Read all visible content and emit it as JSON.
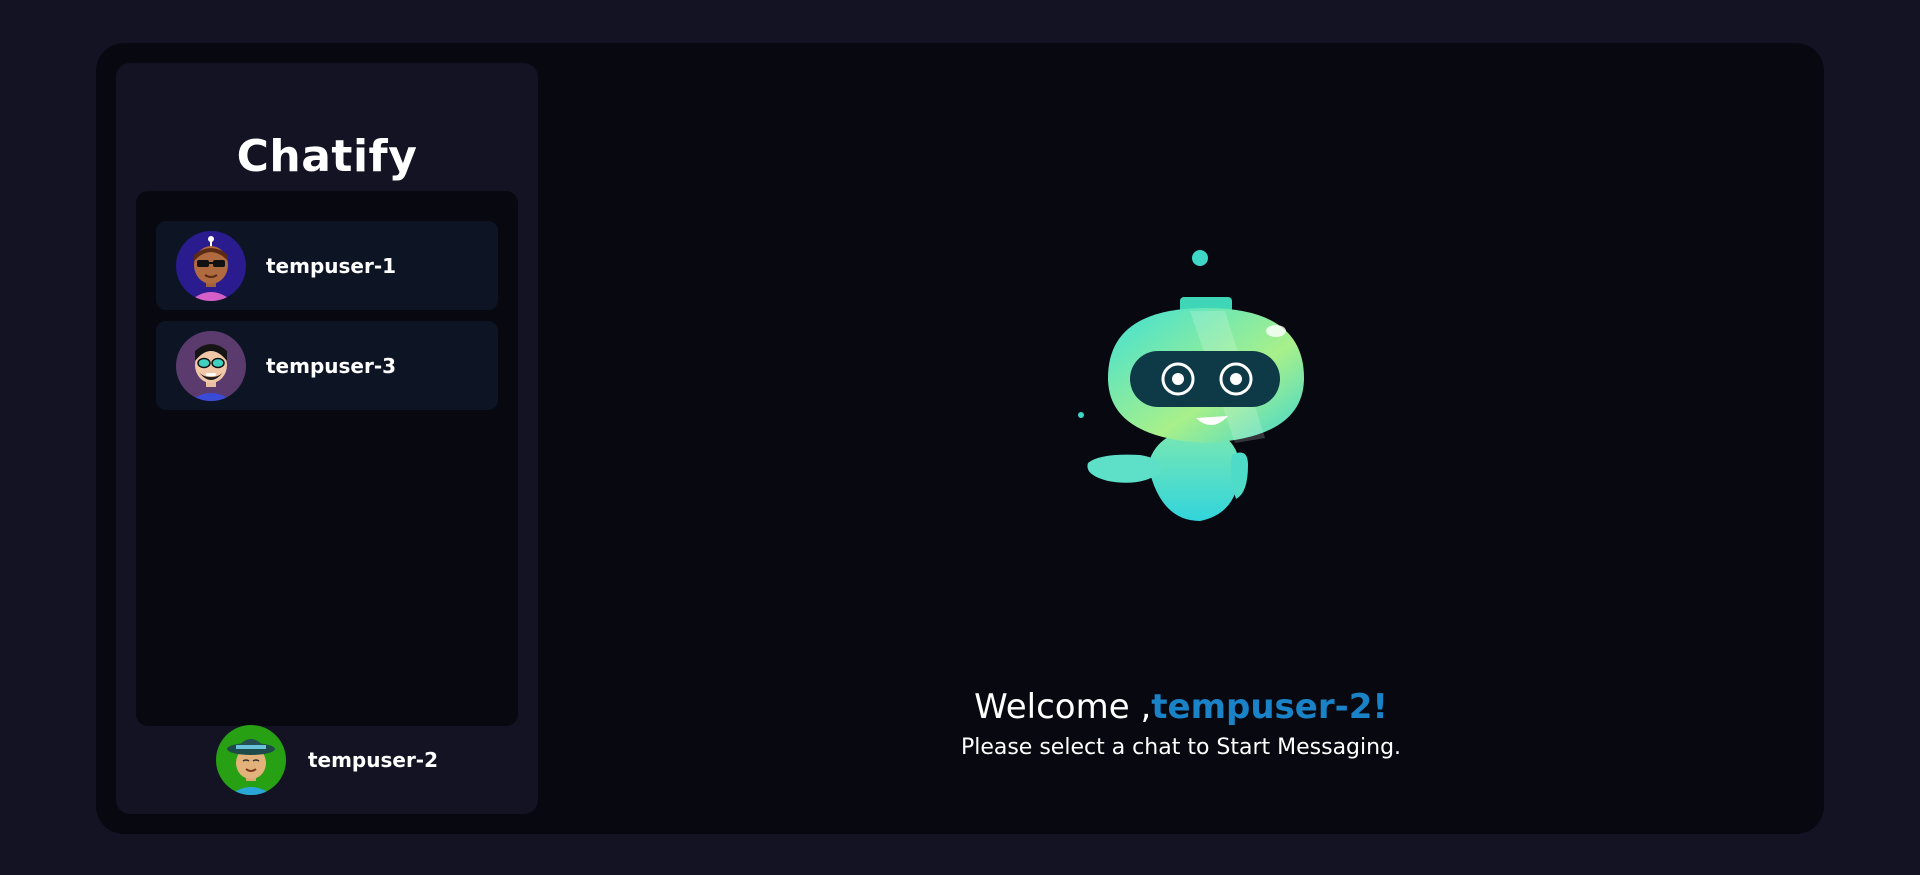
{
  "app": {
    "brand": "Chatify"
  },
  "contacts": [
    {
      "name": "tempuser-1",
      "avatar": "avatar-sunglasses-icon"
    },
    {
      "name": "tempuser-3",
      "avatar": "avatar-bearded-icon"
    }
  ],
  "current_user": {
    "name": "tempuser-2",
    "avatar": "avatar-hat-icon"
  },
  "welcome": {
    "greeting": "Welcome ,",
    "username": "tempuser-2!",
    "subtitle": "Please select a chat to Start Messaging.",
    "illustration": "robot-icon"
  },
  "colors": {
    "background": "#131324",
    "panel": "#080810",
    "contact_card": "#0d1525",
    "accent": "#1a82c6"
  }
}
